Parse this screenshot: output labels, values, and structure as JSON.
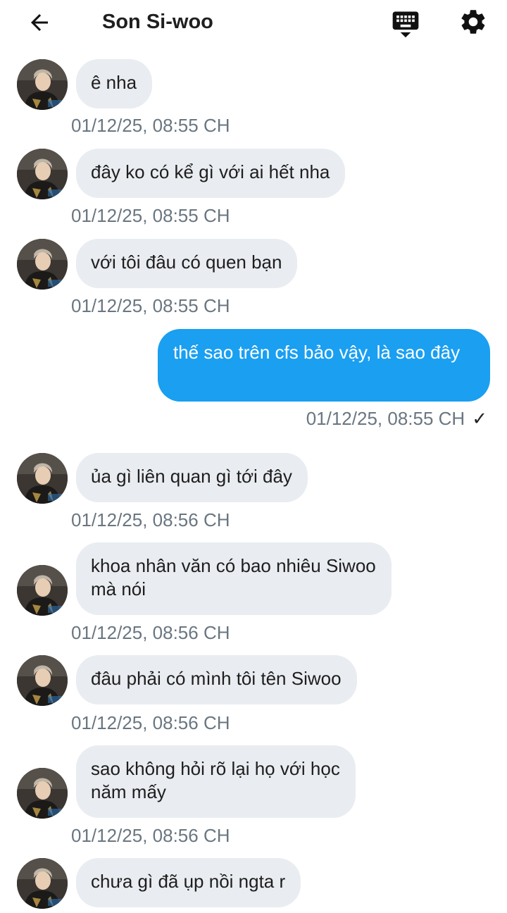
{
  "header": {
    "title": "Son Si-woo",
    "back_icon": "arrow-left-icon",
    "keyboard_icon": "keyboard-hide-icon",
    "settings_icon": "gear-icon"
  },
  "colors": {
    "incoming_bubble": "#e9ecf0",
    "outgoing_bubble": "#1a9ff1",
    "timestamp": "#6a7680"
  },
  "messages": [
    {
      "direction": "in",
      "text": "ê nha",
      "time": "01/12/25, 08:55 CH"
    },
    {
      "direction": "in",
      "text": "đây ko có kể gì với ai hết nha",
      "time": "01/12/25, 08:55 CH"
    },
    {
      "direction": "in",
      "text": "với tôi đâu có quen bạn",
      "time": "01/12/25, 08:55 CH"
    },
    {
      "direction": "out",
      "text": "thế sao trên cfs bảo vậy, là sao đây",
      "time": "01/12/25, 08:55 CH",
      "status": "✓"
    },
    {
      "direction": "in",
      "text": "ủa gì liên quan gì tới đây",
      "time": "01/12/25, 08:56 CH"
    },
    {
      "direction": "in",
      "text": "khoa nhân văn có bao nhiêu Siwoo\nmà nói",
      "time": "01/12/25, 08:56 CH"
    },
    {
      "direction": "in",
      "text": "đâu phải có mình tôi tên Siwoo",
      "time": "01/12/25, 08:56 CH"
    },
    {
      "direction": "in",
      "text": "sao không hỏi rõ lại họ với học\nnăm mấy",
      "time": "01/12/25, 08:56 CH"
    },
    {
      "direction": "in",
      "text": "chưa gì đã ụp nồi ngta r",
      "time": ""
    }
  ]
}
